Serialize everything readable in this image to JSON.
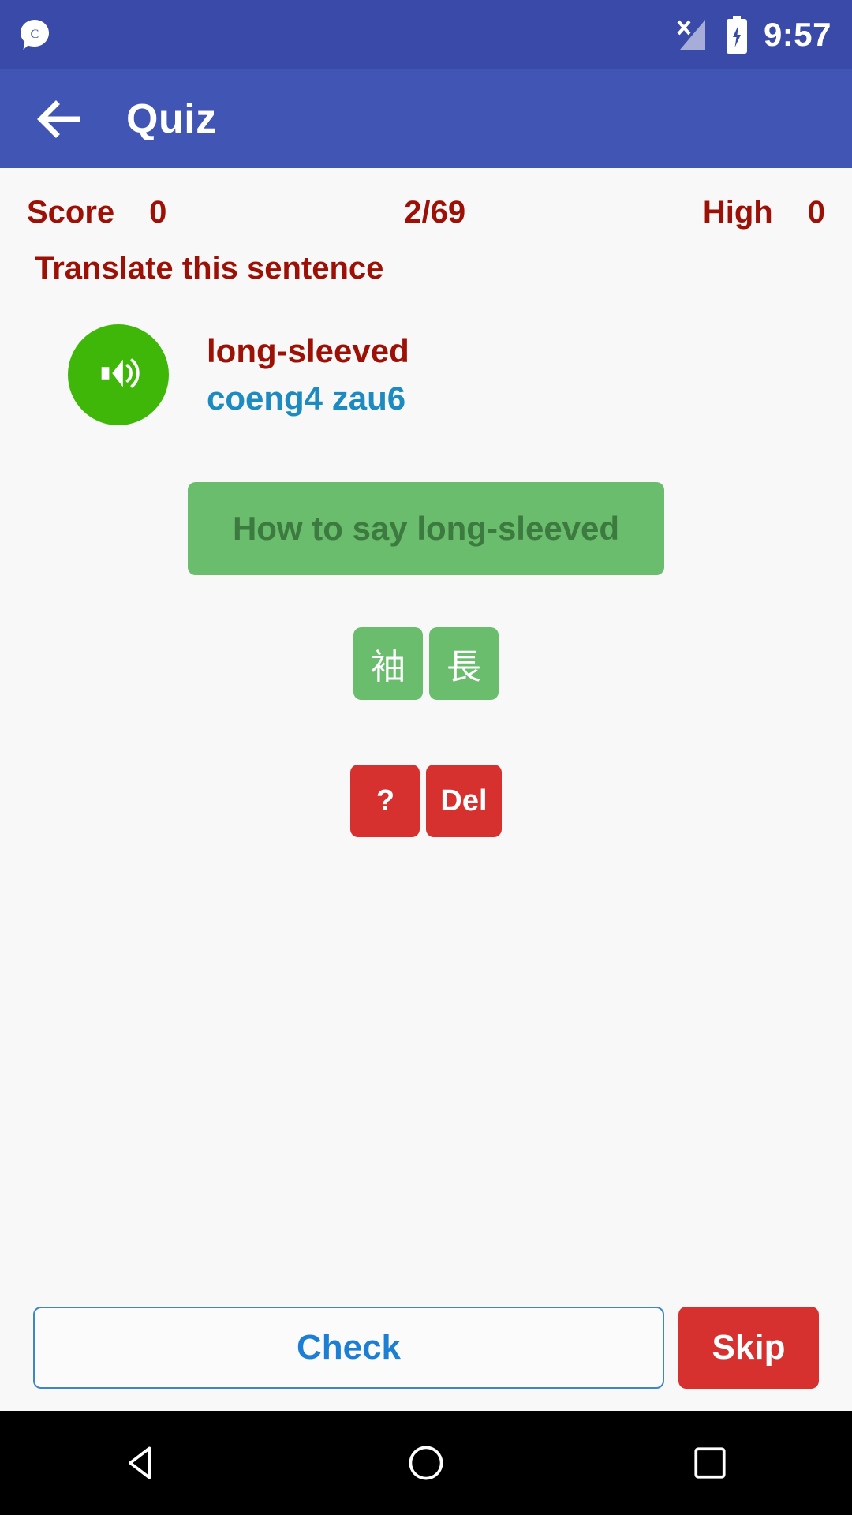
{
  "status_bar": {
    "time": "9:57",
    "notification_icon": "chat-bubble-icon",
    "signal_icon": "signal-no-service-icon",
    "battery_icon": "battery-charging-icon",
    "background_color": "#3a4aa8"
  },
  "app_bar": {
    "back_icon": "back-arrow-icon",
    "title": "Quiz",
    "background_color": "#4055b4"
  },
  "scoreboard": {
    "score_label": "Score",
    "score_value": "0",
    "progress": "2/69",
    "high_label": "High",
    "high_value": "0",
    "text_color": "#9c1006"
  },
  "prompt": {
    "text": "Translate this sentence"
  },
  "question": {
    "speaker_icon": "speaker-volume-icon",
    "speaker_color": "#3fb709",
    "english": "long-sleeved",
    "romanization": "coeng4 zau6",
    "english_color": "#9c1006",
    "romanization_color": "#1e8bc0"
  },
  "answer_slot": {
    "placeholder": "How to say long-sleeved",
    "background_color": "#69bd6d",
    "text_color": "#3d7a40"
  },
  "tiles": [
    {
      "label": "袖",
      "name": "tile-character-1"
    },
    {
      "label": "長",
      "name": "tile-character-2"
    }
  ],
  "actions": [
    {
      "label": "?",
      "name": "hint-button"
    },
    {
      "label": "Del",
      "name": "delete-button"
    }
  ],
  "bottom": {
    "check_label": "Check",
    "skip_label": "Skip",
    "check_color": "#1d7fd4",
    "skip_color": "#d6302f"
  },
  "nav_bar": {
    "back_icon": "nav-back-triangle-icon",
    "home_icon": "nav-home-circle-icon",
    "recents_icon": "nav-recents-square-icon"
  }
}
